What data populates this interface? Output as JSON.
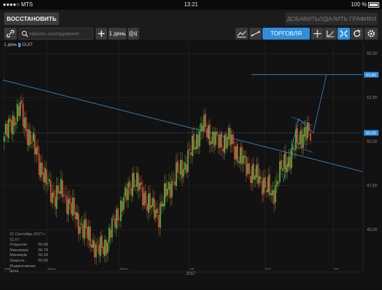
{
  "status_bar": {
    "carrier": "●●●●○ MTS",
    "time": "13:21",
    "battery": "100 %"
  },
  "top_bar": {
    "restore_label": "ВОССТАНОВИТЬ",
    "add_remove_label": "ДОБАВИТЬ/УДАЛИТЬ ГРАФИКИ"
  },
  "toolbar": {
    "search_placeholder": "Найти инструмент",
    "timeframe_label": "1 день",
    "trade_label": "ТОРГОВЛЯ",
    "icons": [
      "link-icon",
      "search-icon",
      "plus-icon",
      "bar-chart-icon",
      "indicator-icon",
      "line-tool-icon",
      "crosshair-icon",
      "trend-icon",
      "fullscreen-icon",
      "refresh-icon",
      "settings-icon"
    ]
  },
  "chart": {
    "timeframe": "1 день",
    "symbol": "CLX7",
    "info_date": "21 Сентябрь 2017 г.",
    "info_symbol": "CLX7",
    "info_rows": [
      {
        "label": "Открытие",
        "value": "50,68"
      },
      {
        "label": "Максимум",
        "value": "50,78"
      },
      {
        "label": "Минимум",
        "value": "50,34"
      },
      {
        "label": "Закрыть",
        "value": "50,50"
      },
      {
        "label": "Индикативная цена",
        "value": ""
      }
    ],
    "year_label": "2017",
    "price_tags": {
      "target": "53,80",
      "current": "50,50"
    }
  },
  "chart_data": {
    "type": "candlestick",
    "y_ticks": [
      "55,00",
      "52,50",
      "50,00",
      "47,50",
      "45,00"
    ],
    "ylim": [
      42.8,
      55.6
    ],
    "x_ticks": [
      "Май",
      "Июнь",
      "Июль",
      "Авг",
      "Сен",
      "Окт"
    ],
    "colors": {
      "up": "#3fb83a",
      "down": "#e0423a",
      "lines": "#3d8fd0",
      "background": "#121212"
    }
  }
}
